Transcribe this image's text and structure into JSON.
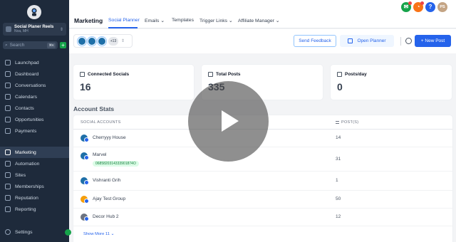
{
  "sidebar": {
    "account_name": "Social Planer Reels",
    "account_location": "Noa, MH",
    "search_placeholder": "Search",
    "search_shortcut": "⌘K",
    "items": [
      {
        "label": "Launchpad",
        "icon": "rocket-icon"
      },
      {
        "label": "Dashboard",
        "icon": "dashboard-icon"
      },
      {
        "label": "Conversations",
        "icon": "chat-icon"
      },
      {
        "label": "Calendars",
        "icon": "calendar-icon"
      },
      {
        "label": "Contacts",
        "icon": "contacts-icon"
      },
      {
        "label": "Opportunities",
        "icon": "opportunities-icon"
      },
      {
        "label": "Payments",
        "icon": "payments-icon"
      },
      {
        "label": "Marketing",
        "icon": "send-icon",
        "active": true
      },
      {
        "label": "Automation",
        "icon": "automation-icon"
      },
      {
        "label": "Sites",
        "icon": "globe-icon"
      },
      {
        "label": "Memberships",
        "icon": "memberships-icon"
      },
      {
        "label": "Reputation",
        "icon": "star-icon"
      },
      {
        "label": "Reporting",
        "icon": "chart-icon"
      }
    ],
    "settings_label": "Settings"
  },
  "topbar": {
    "title": "Marketing",
    "tabs": [
      {
        "label": "Social Planner",
        "active": true
      },
      {
        "label": "Emails ⌄"
      },
      {
        "label": "Templates"
      },
      {
        "label": "Trigger Links ⌄"
      },
      {
        "label": "Affiliate Manager ⌄"
      }
    ],
    "user_initials": "PS",
    "help_label": "?",
    "colors": {
      "megaphone": "#16a34a",
      "bell": "#f97316",
      "help": "#2563eb",
      "avatar": "#c4a484"
    }
  },
  "toolbar": {
    "more_accounts": "+13",
    "send_feedback": "Send Feedback",
    "open_planner": "Open Planner",
    "new_post": "+ New Post"
  },
  "stats": [
    {
      "label": "Connected Socials",
      "value": "16"
    },
    {
      "label": "Total Posts",
      "value": "335"
    },
    {
      "label": "Posts/day",
      "value": "0"
    }
  ],
  "account_stats": {
    "title": "Account Stats",
    "col_accounts": "SOCIAL ACCOUNTS",
    "col_posts": "POST(S)",
    "rows": [
      {
        "name": "Cherryyy House",
        "posts": "14",
        "tag": ""
      },
      {
        "name": "Marvel",
        "posts": "31",
        "tag": "0685820314333901874O"
      },
      {
        "name": "Vishranti Grih",
        "posts": "1",
        "tag": ""
      },
      {
        "name": "Ajay Test Group",
        "posts": "50",
        "tag": ""
      },
      {
        "name": "Decor Hub 2",
        "posts": "12",
        "tag": ""
      }
    ],
    "show_more": "Show More 11 ⌄"
  }
}
